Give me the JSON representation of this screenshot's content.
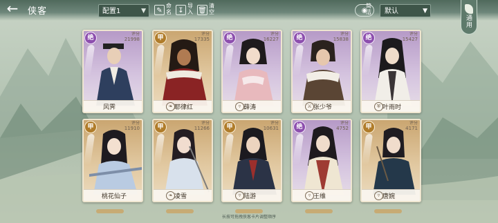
{
  "header": {
    "title": "侠客",
    "preset": "配置1",
    "tools": [
      {
        "name": "rename",
        "label": "命名",
        "icon": "pencil-icon"
      },
      {
        "name": "import",
        "label": "导入",
        "icon": "import-icon"
      },
      {
        "name": "clear",
        "label": "清空",
        "icon": "trash-icon"
      }
    ],
    "simplified_label": "简洁",
    "sort": "默认",
    "apply_label": "通用"
  },
  "cards": [
    {
      "grade": "绝",
      "name": "风霁",
      "stat_label": "评分",
      "stat_value": "21998",
      "class_icon": "none"
    },
    {
      "grade": "甲",
      "name": "耶律红",
      "stat_label": "评分",
      "stat_value": "17335",
      "class_icon": "bow-icon"
    },
    {
      "grade": "绝",
      "name": "薛涛",
      "stat_label": "评分",
      "stat_value": "16227",
      "class_icon": "fan-icon"
    },
    {
      "grade": "绝",
      "name": "张少爷",
      "stat_label": "评分",
      "stat_value": "15838",
      "class_icon": "sword-icon"
    },
    {
      "grade": "绝",
      "name": "叶雨时",
      "stat_label": "评分",
      "stat_value": "15427",
      "class_icon": "shield-icon"
    },
    {
      "grade": "甲",
      "name": "桃花仙子",
      "stat_label": "评分",
      "stat_value": "11910",
      "class_icon": "none"
    },
    {
      "grade": "甲",
      "name": "凌雪",
      "stat_label": "评分",
      "stat_value": "11266",
      "class_icon": "bow-icon"
    },
    {
      "grade": "甲",
      "name": "陆游",
      "stat_label": "评分",
      "stat_value": "10631",
      "class_icon": "fan-icon"
    },
    {
      "grade": "绝",
      "name": "王维",
      "stat_label": "评分",
      "stat_value": "4752",
      "class_icon": "fan-icon"
    },
    {
      "grade": "甲",
      "name": "唐婉",
      "stat_label": "评分",
      "stat_value": "4171",
      "class_icon": "fan-icon"
    }
  ],
  "footer": {
    "hint": "长按可拖拽侠客卡片调整顺序"
  }
}
